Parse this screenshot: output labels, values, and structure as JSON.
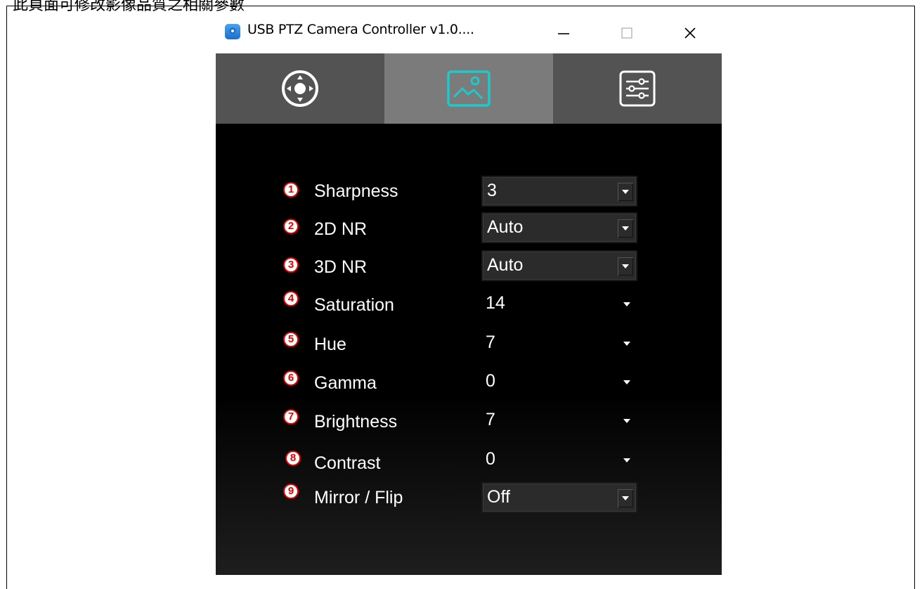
{
  "document": {
    "caption": "此頁面可修改影像品質之相關參數"
  },
  "window": {
    "title": "USB PTZ Camera Controller v1.0....",
    "icons": {
      "app": "camera-app-icon",
      "minimize": "minimize-icon",
      "maximize": "maximize-icon",
      "close": "close-icon"
    }
  },
  "tabs": [
    {
      "name": "ptz-control",
      "icon": "joystick-icon",
      "active": false
    },
    {
      "name": "image",
      "icon": "image-icon",
      "active": true,
      "accent": "#1ec9c9"
    },
    {
      "name": "settings",
      "icon": "sliders-icon",
      "active": false
    }
  ],
  "image_settings": {
    "rows": [
      {
        "num": "1",
        "label": "Sharpness",
        "value": "3",
        "style": "combo"
      },
      {
        "num": "2",
        "label": "2D NR",
        "value": "Auto",
        "style": "combo"
      },
      {
        "num": "3",
        "label": "3D NR",
        "value": "Auto",
        "style": "combo"
      },
      {
        "num": "4",
        "label": "Saturation",
        "value": "14",
        "style": "plain"
      },
      {
        "num": "5",
        "label": "Hue",
        "value": "7",
        "style": "plain"
      },
      {
        "num": "6",
        "label": "Gamma",
        "value": "0",
        "style": "plain"
      },
      {
        "num": "7",
        "label": "Brightness",
        "value": "7",
        "style": "plain"
      },
      {
        "num": "8",
        "label": "Contrast",
        "value": "0",
        "style": "plain"
      },
      {
        "num": "9",
        "label": "Mirror / Flip",
        "value": "Off",
        "style": "combo"
      }
    ]
  },
  "colors": {
    "badge_red": "#e10000",
    "tab_bar": "#535353",
    "tab_active": "#7b7b7b",
    "accent_teal": "#1ec9c9"
  }
}
